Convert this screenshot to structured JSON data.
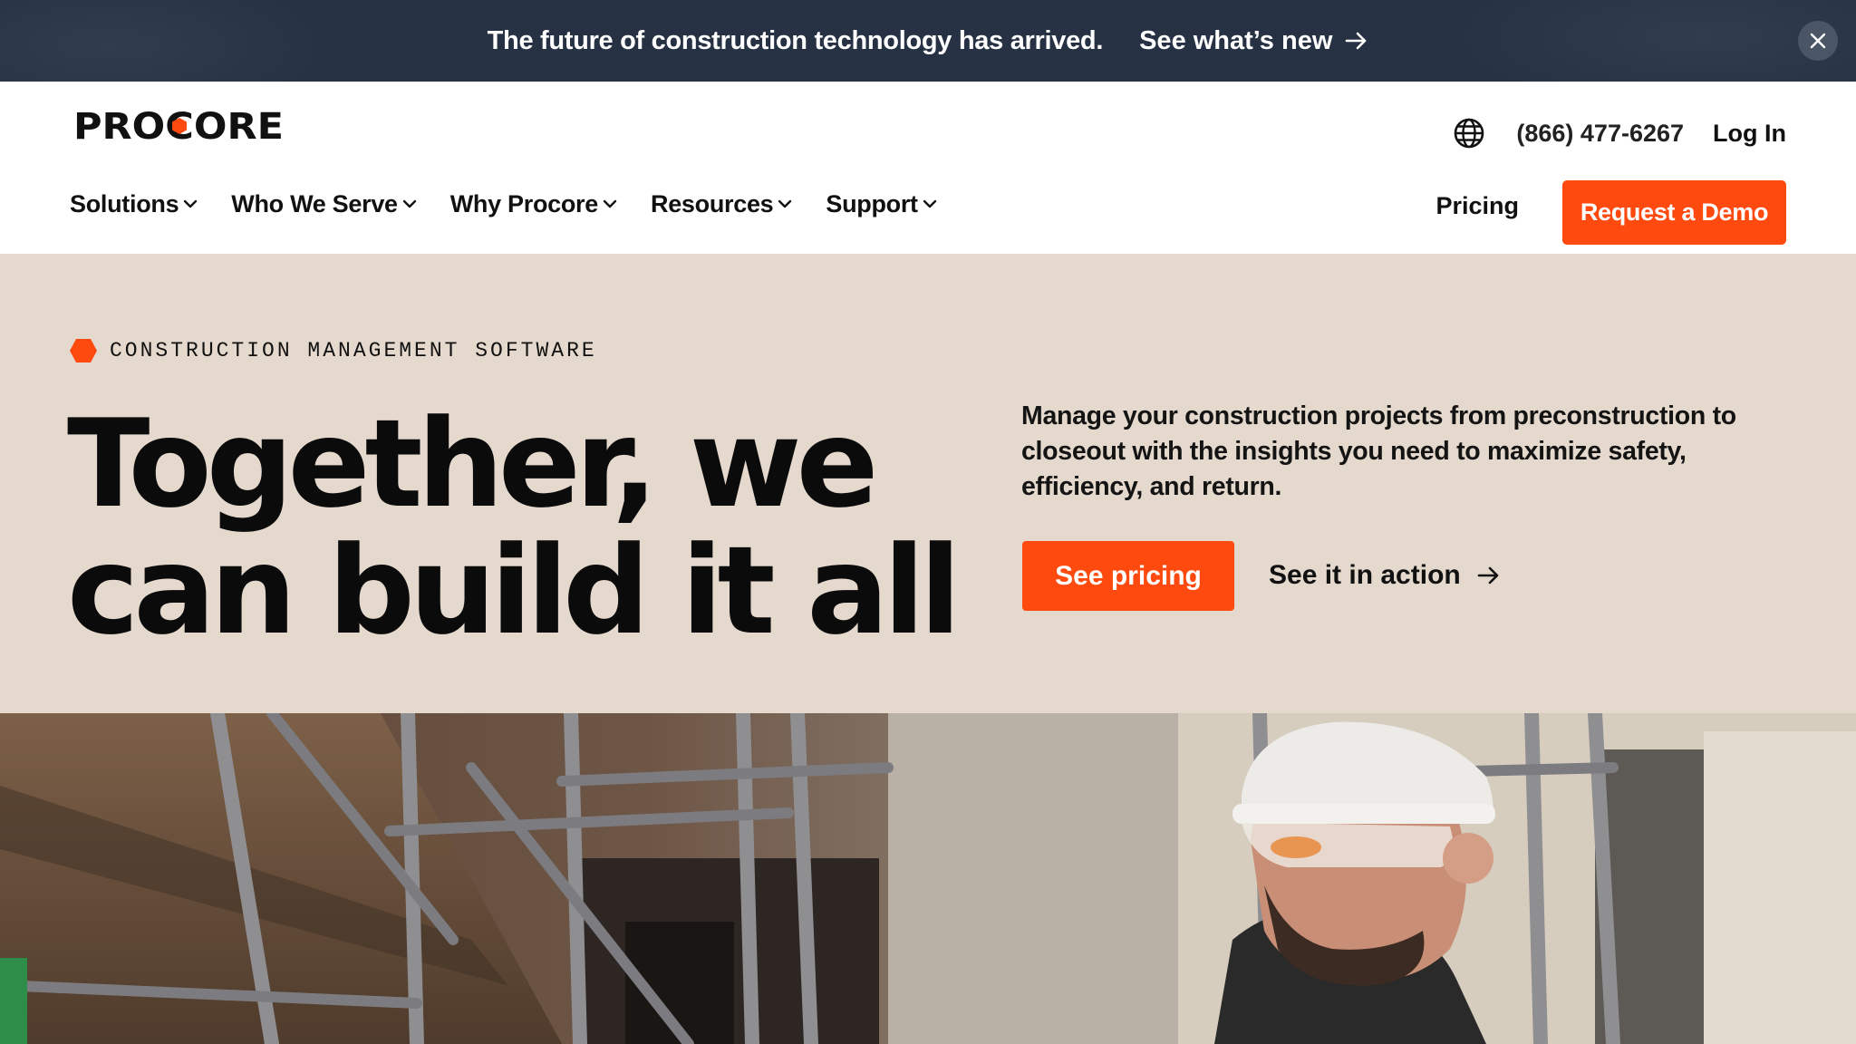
{
  "banner": {
    "message": "The future of construction technology has arrived.",
    "link_label": "See what’s new",
    "link_icon": "arrow-right-icon",
    "close_icon": "close-icon"
  },
  "header": {
    "logo_text": "PROCORE",
    "globe_icon": "globe-icon",
    "phone": "(866) 477-6267",
    "login_label": "Log In"
  },
  "nav": {
    "items": [
      {
        "label": "Solutions"
      },
      {
        "label": "Who We Serve"
      },
      {
        "label": "Why Procore"
      },
      {
        "label": "Resources"
      },
      {
        "label": "Support"
      }
    ],
    "pricing_label": "Pricing",
    "demo_label": "Request a Demo"
  },
  "hero": {
    "eyebrow": "CONSTRUCTION MANAGEMENT SOFTWARE",
    "headline_line1": "Together, we",
    "headline_line2": "can build it all",
    "description": "Manage your construction projects from preconstruction to closeout with the insights you need to maximize safety, efficiency, and return.",
    "primary_cta": "See pricing",
    "secondary_cta": "See it in action"
  },
  "colors": {
    "accent": "#ff4a0f",
    "banner_bg": "#263243",
    "hero_bg": "#e5d9ce"
  }
}
